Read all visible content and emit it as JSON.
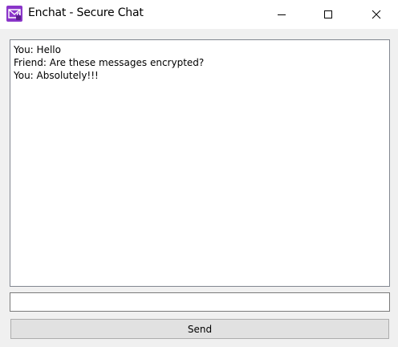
{
  "window": {
    "title": "Enchat - Secure Chat",
    "app_icon": "envelope-lock-icon",
    "controls": {
      "minimize_icon": "minimize-icon",
      "maximize_icon": "maximize-icon",
      "close_icon": "close-icon"
    }
  },
  "chat": {
    "messages": [
      {
        "text": "You: Hello"
      },
      {
        "text": "Friend: Are these messages encrypted?"
      },
      {
        "text": "You: Absolutely!!!"
      }
    ]
  },
  "input": {
    "value": "",
    "placeholder": ""
  },
  "send_button": {
    "label": "Send"
  },
  "colors": {
    "icon_purple": "#7b2fbe",
    "window_bg": "#f0f0f0",
    "button_bg": "#e1e1e1"
  }
}
